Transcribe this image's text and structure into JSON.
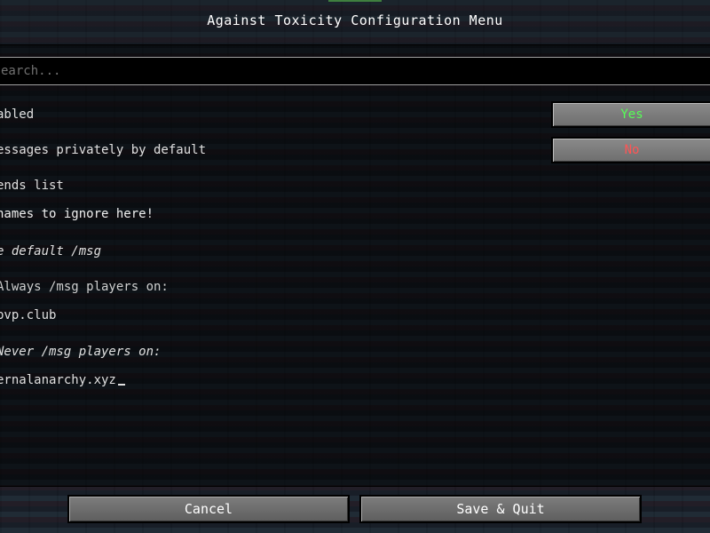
{
  "window": {
    "title": "Against Toxicity Configuration Menu"
  },
  "search": {
    "placeholder": "earch..."
  },
  "options": {
    "enabled_label": "abled",
    "enabled_value": "Yes",
    "private_label": "essages privately by default",
    "private_value": "No",
    "friends_label": "ends list",
    "friends_value": "names to ignore here!",
    "default_msg_label": "e default /msg",
    "always_label": "Always /msg players on:",
    "always_value": "pvp.club",
    "never_label": "Never /msg players on:",
    "never_value": "ernalanarchy.xyz"
  },
  "buttons": {
    "cancel": "Cancel",
    "save_quit": "Save & Quit"
  },
  "colors": {
    "yes": "#55ff55",
    "no": "#ff5555"
  }
}
